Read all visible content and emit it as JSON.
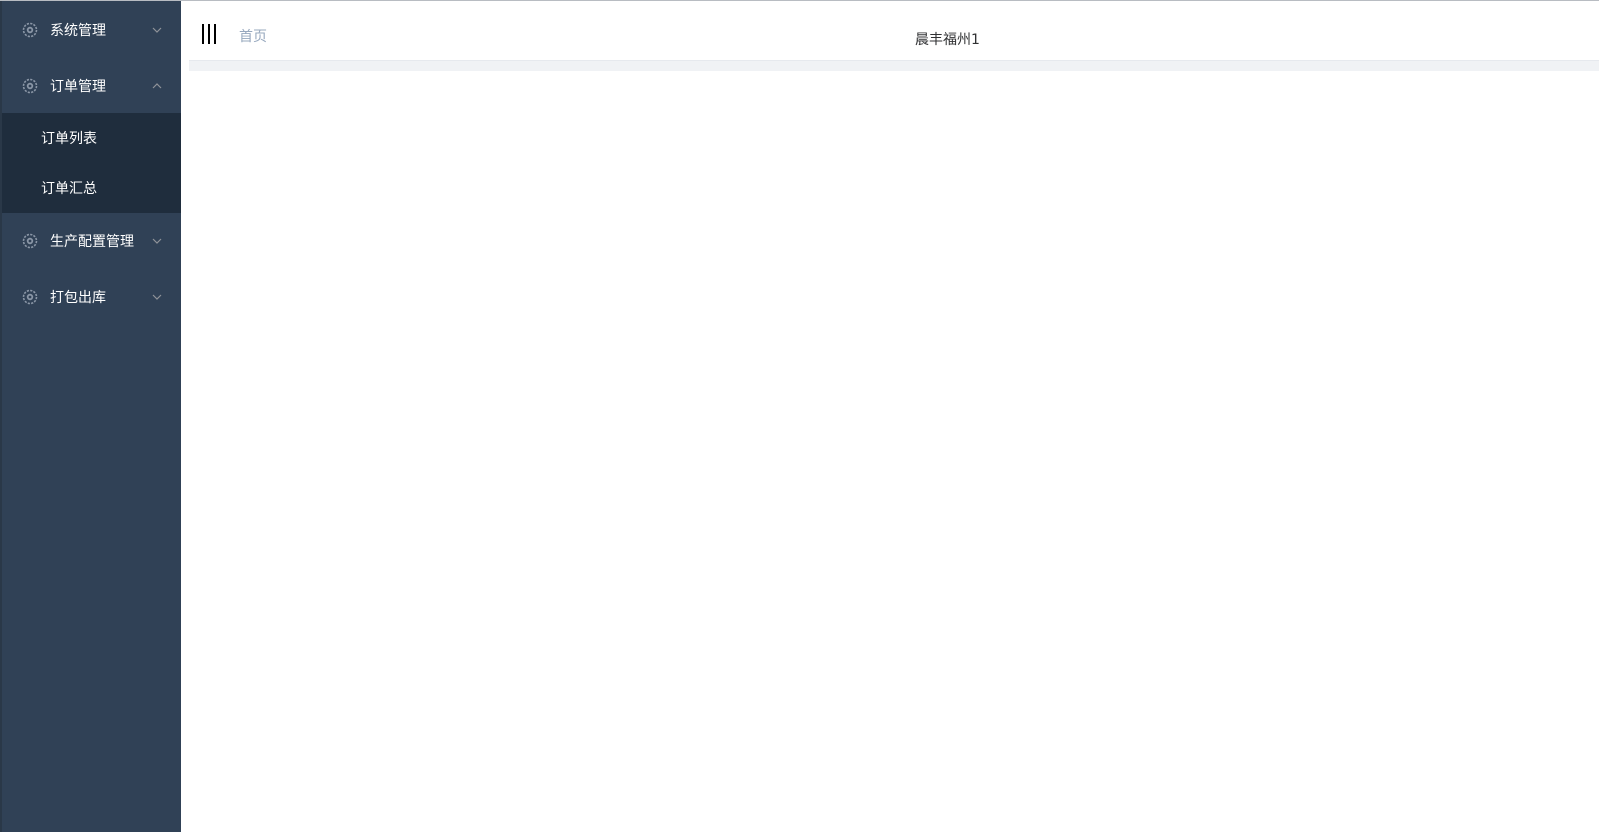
{
  "sidebar": {
    "menus": [
      {
        "label": "系统管理",
        "icon": "gear-icon",
        "expanded": false
      },
      {
        "label": "订单管理",
        "icon": "gear-icon",
        "expanded": true,
        "children": [
          {
            "label": "订单列表"
          },
          {
            "label": "订单汇总"
          }
        ]
      },
      {
        "label": "生产配置管理",
        "icon": "gear-icon",
        "expanded": false
      },
      {
        "label": "打包出库",
        "icon": "gear-icon",
        "expanded": false
      }
    ],
    "colors": {
      "background": "#304156",
      "submenu_background": "#1f2d3d",
      "text": "#ffffff"
    }
  },
  "header": {
    "hamburger_icon": "hamburger-icon",
    "breadcrumb": "首页",
    "company": "晨丰福州1"
  }
}
